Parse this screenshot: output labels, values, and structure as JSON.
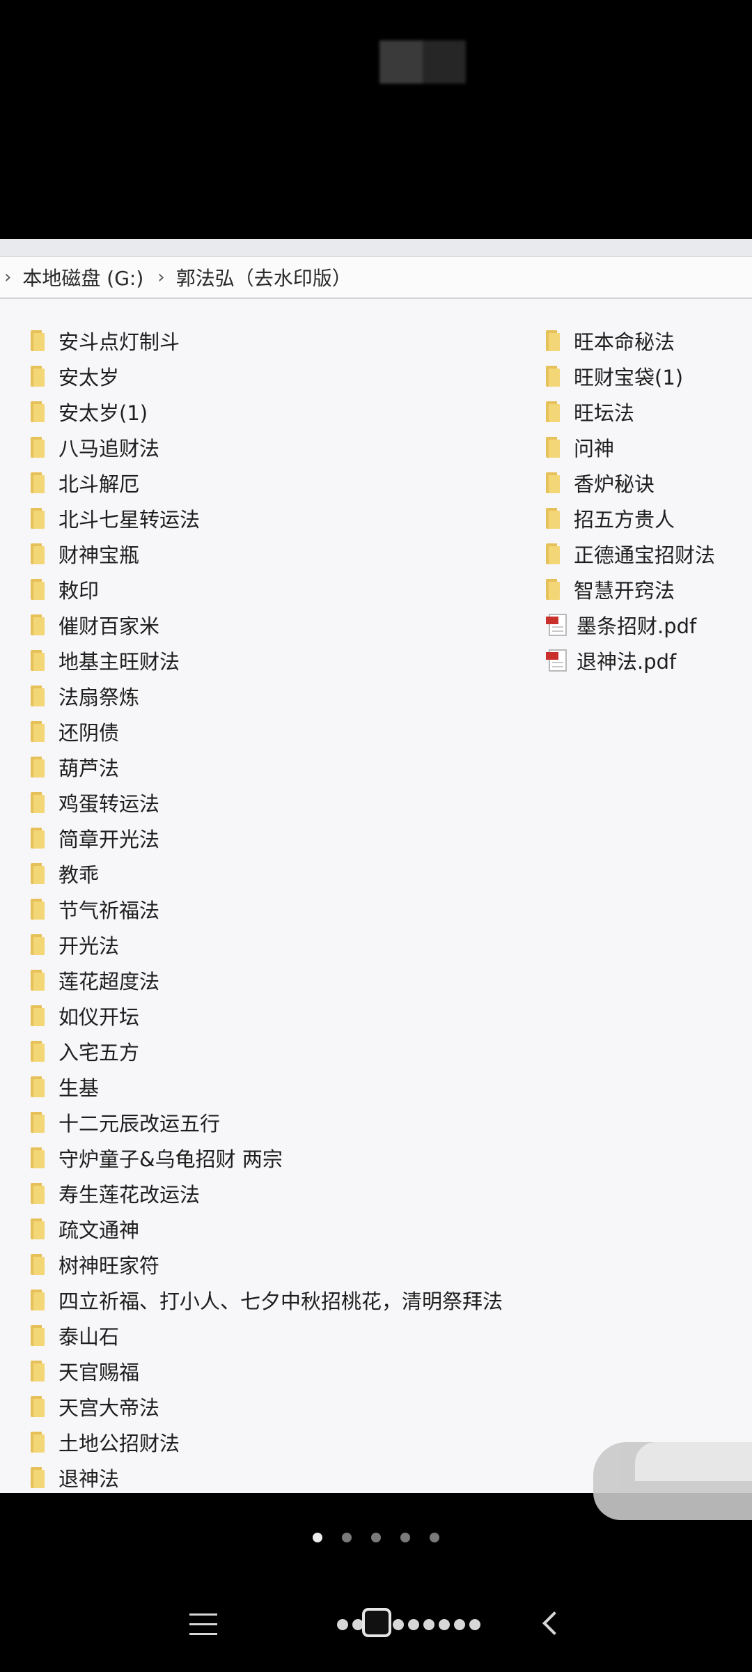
{
  "breadcrumb": {
    "drive": "本地磁盘 (G:)",
    "folder": "郭法弘（去水印版）",
    "separator": "›"
  },
  "column1": [
    {
      "name": "安斗点灯制斗",
      "type": "folder"
    },
    {
      "name": "安太岁",
      "type": "folder"
    },
    {
      "name": "安太岁(1)",
      "type": "folder"
    },
    {
      "name": "八马追财法",
      "type": "folder"
    },
    {
      "name": "北斗解厄",
      "type": "folder"
    },
    {
      "name": "北斗七星转运法",
      "type": "folder"
    },
    {
      "name": "财神宝瓶",
      "type": "folder"
    },
    {
      "name": "敕印",
      "type": "folder"
    },
    {
      "name": "催财百家米",
      "type": "folder"
    },
    {
      "name": "地基主旺财法",
      "type": "folder"
    },
    {
      "name": "法扇祭炼",
      "type": "folder"
    },
    {
      "name": "还阴债",
      "type": "folder"
    },
    {
      "name": "葫芦法",
      "type": "folder"
    },
    {
      "name": "鸡蛋转运法",
      "type": "folder"
    },
    {
      "name": "简章开光法",
      "type": "folder"
    },
    {
      "name": "教乖",
      "type": "folder"
    },
    {
      "name": "节气祈福法",
      "type": "folder"
    },
    {
      "name": "开光法",
      "type": "folder"
    },
    {
      "name": "莲花超度法",
      "type": "folder"
    },
    {
      "name": "如仪开坛",
      "type": "folder"
    },
    {
      "name": "入宅五方",
      "type": "folder"
    },
    {
      "name": "生基",
      "type": "folder"
    },
    {
      "name": "十二元辰改运五行",
      "type": "folder"
    },
    {
      "name": "守炉童子&乌龟招财 两宗",
      "type": "folder"
    },
    {
      "name": "寿生莲花改运法",
      "type": "folder"
    },
    {
      "name": "疏文通神",
      "type": "folder"
    },
    {
      "name": "树神旺家符",
      "type": "folder"
    },
    {
      "name": "四立祈福、打小人、七夕中秋招桃花，清明祭拜法",
      "type": "folder"
    },
    {
      "name": "泰山石",
      "type": "folder"
    },
    {
      "name": "天官赐福",
      "type": "folder"
    },
    {
      "name": "天宫大帝法",
      "type": "folder"
    },
    {
      "name": "土地公招财法",
      "type": "folder"
    },
    {
      "name": "退神法",
      "type": "folder"
    }
  ],
  "column2": [
    {
      "name": "旺本命秘法",
      "type": "folder"
    },
    {
      "name": "旺财宝袋(1)",
      "type": "folder"
    },
    {
      "name": "旺坛法",
      "type": "folder"
    },
    {
      "name": "问神",
      "type": "folder"
    },
    {
      "name": "香炉秘诀",
      "type": "folder"
    },
    {
      "name": "招五方贵人",
      "type": "folder"
    },
    {
      "name": "正德通宝招财法",
      "type": "folder"
    },
    {
      "name": "智慧开窍法",
      "type": "folder"
    },
    {
      "name": "墨条招财.pdf",
      "type": "pdf"
    },
    {
      "name": "退神法.pdf",
      "type": "pdf"
    }
  ],
  "colors": {
    "folder": "#f3d675",
    "pdf_tag": "#c9302c",
    "explorer_bg": "#f7f7f9",
    "background": "#000000"
  },
  "pager": {
    "count": 5,
    "active": 0
  }
}
